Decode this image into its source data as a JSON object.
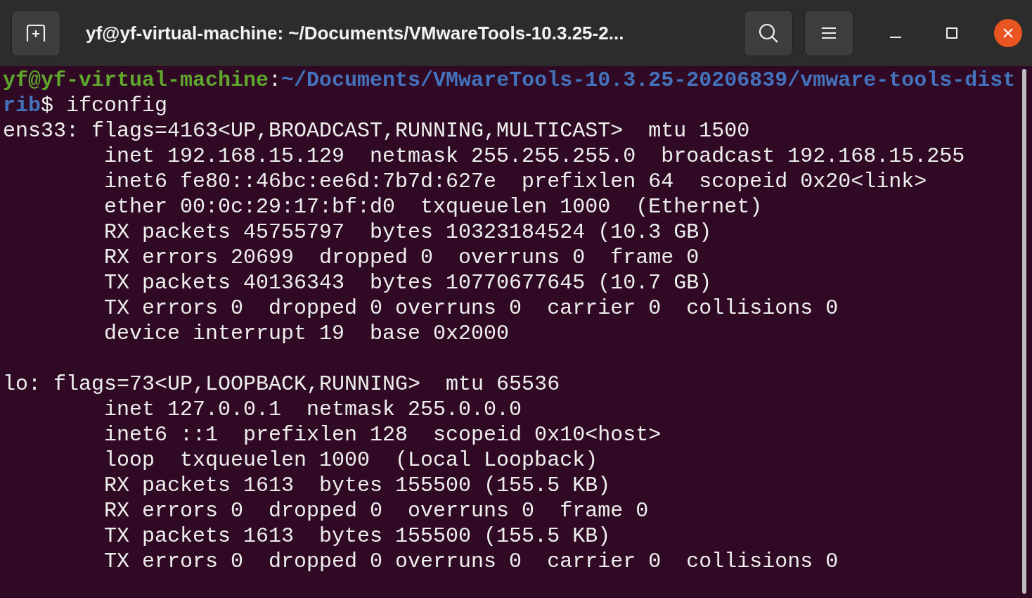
{
  "window": {
    "title": "yf@yf-virtual-machine: ~/Documents/VMwareTools-10.3.25-2..."
  },
  "terminal": {
    "sections": [
      {
        "lines": [
          {
            "segments": [
              {
                "kind": "user",
                "text": "yf@yf-virtual-machine"
              },
              {
                "kind": "plain",
                "text": ":"
              },
              {
                "kind": "path",
                "text": "~/Documents/VMwareTools-10.3.25-20206839/vmware-tools-dist"
              }
            ]
          },
          {
            "segments": [
              {
                "kind": "path",
                "text": "rib"
              },
              {
                "kind": "plain",
                "text": "$ ifconfig"
              }
            ]
          },
          {
            "segments": [
              {
                "kind": "plain",
                "text": "ens33: flags=4163<UP,BROADCAST,RUNNING,MULTICAST>  mtu 1500"
              }
            ]
          },
          {
            "segments": [
              {
                "kind": "plain",
                "text": "        inet 192.168.15.129  netmask 255.255.255.0  broadcast 192.168.15.255"
              }
            ]
          },
          {
            "segments": [
              {
                "kind": "plain",
                "text": "        inet6 fe80::46bc:ee6d:7b7d:627e  prefixlen 64  scopeid 0x20<link>"
              }
            ]
          },
          {
            "segments": [
              {
                "kind": "plain",
                "text": "        ether 00:0c:29:17:bf:d0  txqueuelen 1000  (Ethernet)"
              }
            ]
          },
          {
            "segments": [
              {
                "kind": "plain",
                "text": "        RX packets 45755797  bytes 10323184524 (10.3 GB)"
              }
            ]
          },
          {
            "segments": [
              {
                "kind": "plain",
                "text": "        RX errors 20699  dropped 0  overruns 0  frame 0"
              }
            ]
          },
          {
            "segments": [
              {
                "kind": "plain",
                "text": "        TX packets 40136343  bytes 10770677645 (10.7 GB)"
              }
            ]
          },
          {
            "segments": [
              {
                "kind": "plain",
                "text": "        TX errors 0  dropped 0 overruns 0  carrier 0  collisions 0"
              }
            ]
          },
          {
            "segments": [
              {
                "kind": "plain",
                "text": "        device interrupt 19  base 0x2000"
              }
            ]
          }
        ]
      },
      {
        "lines": [
          {
            "segments": [
              {
                "kind": "plain",
                "text": "lo: flags=73<UP,LOOPBACK,RUNNING>  mtu 65536"
              }
            ]
          },
          {
            "segments": [
              {
                "kind": "plain",
                "text": "        inet 127.0.0.1  netmask 255.0.0.0"
              }
            ]
          },
          {
            "segments": [
              {
                "kind": "plain",
                "text": "        inet6 ::1  prefixlen 128  scopeid 0x10<host>"
              }
            ]
          },
          {
            "segments": [
              {
                "kind": "plain",
                "text": "        loop  txqueuelen 1000  (Local Loopback)"
              }
            ]
          },
          {
            "segments": [
              {
                "kind": "plain",
                "text": "        RX packets 1613  bytes 155500 (155.5 KB)"
              }
            ]
          },
          {
            "segments": [
              {
                "kind": "plain",
                "text": "        RX errors 0  dropped 0  overruns 0  frame 0"
              }
            ]
          },
          {
            "segments": [
              {
                "kind": "plain",
                "text": "        TX packets 1613  bytes 155500 (155.5 KB)"
              }
            ]
          },
          {
            "segments": [
              {
                "kind": "plain",
                "text": "        TX errors 0  dropped 0 overruns 0  carrier 0  collisions 0"
              }
            ]
          }
        ]
      }
    ]
  }
}
